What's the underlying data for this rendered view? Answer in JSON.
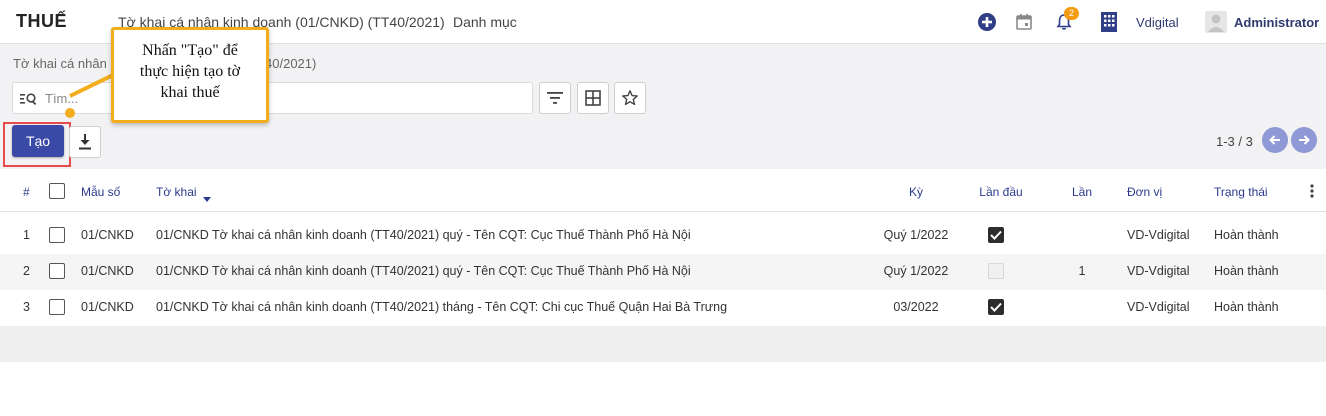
{
  "app": {
    "brand": "THUẾ",
    "nav": [
      "Tờ khai cá nhân kinh doanh (01/CNKD) (TT40/2021)",
      "Danh mục"
    ],
    "notifications_count": "2",
    "company": "Vdigital",
    "user": "Administrator",
    "icons": [
      "plus-circle-icon",
      "calendar-icon",
      "bell-icon",
      "building-icon",
      "avatar-icon"
    ]
  },
  "control": {
    "breadcrumb": "Tờ khai cá nhân kinh doanh (01/CNKD) (TT40/2021)",
    "search_placeholder": "Tìm...",
    "create_label": "Tạo",
    "pager_text": "1-3 / 3"
  },
  "callout": {
    "lines": [
      "Nhấn \"Tạo\" để",
      "thực hiện tạo tờ",
      "khai thuế"
    ]
  },
  "table": {
    "headers": {
      "index": "#",
      "form": "Mẫu số",
      "declaration": "Tờ khai",
      "period": "Kỳ",
      "first_time": "Lần đầu",
      "times": "Lần",
      "unit": "Đơn vị",
      "status": "Trạng thái"
    },
    "rows": [
      {
        "index": "1",
        "form": "01/CNKD",
        "declaration": "01/CNKD Tờ khai cá nhân kinh doanh (TT40/2021) quý - Tên CQT: Cục Thuế Thành Phố Hà Nội",
        "period": "Quý 1/2022",
        "first_time": true,
        "times": "",
        "unit": "VD-Vdigital",
        "status": "Hoàn thành"
      },
      {
        "index": "2",
        "form": "01/CNKD",
        "declaration": "01/CNKD Tờ khai cá nhân kinh doanh (TT40/2021) quý - Tên CQT: Cục Thuế Thành Phố Hà Nội",
        "period": "Quý 1/2022",
        "first_time": false,
        "times": "1",
        "unit": "VD-Vdigital",
        "status": "Hoàn thành"
      },
      {
        "index": "3",
        "form": "01/CNKD",
        "declaration": "01/CNKD Tờ khai cá nhân kinh doanh (TT40/2021) tháng - Tên CQT: Chi cục Thuế Quận Hai Bà Trưng",
        "period": "03/2022",
        "first_time": true,
        "times": "",
        "unit": "VD-Vdigital",
        "status": "Hoàn thành"
      }
    ]
  },
  "colors": {
    "primary": "#3b4aa6",
    "callout_border": "#f1ad1c",
    "highlight_border": "#e74c4c",
    "header_text": "#2b3a8f"
  }
}
